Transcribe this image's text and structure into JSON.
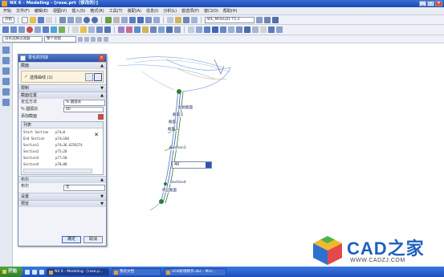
{
  "window": {
    "title": "NX 6 - Modeling - [rose.prt（修改的）]"
  },
  "menu": {
    "items": [
      "开始",
      "文件(F)",
      "编辑(E)",
      "视图(V)",
      "插入(S)",
      "格式(R)",
      "工具(T)",
      "装配(A)",
      "信息(I)",
      "分析(L)",
      "首选项(P)",
      "窗口(O)",
      "帮助(H)"
    ]
  },
  "toolbar": {
    "start_label": "开始",
    "layer_combo": "WE_MOULD1 T5.3",
    "filter_combo": "没有选择过滤器",
    "scope_combo": "整个装配"
  },
  "dialog": {
    "title": "变化的扫掠",
    "sections": {
      "section": "截面",
      "select_curve": "选择曲线 (1)",
      "constraint": "限制",
      "section_position": "截面位置",
      "locate_method_label": "定位方法",
      "locate_method_value": "% 圆弧长",
      "percent_label": "% 圆弧长",
      "percent_value": "40",
      "add_section": "添加截面",
      "list_header": "列表",
      "sections_list": [
        {
          "name": "Start Section",
          "value": "p74=0"
        },
        {
          "name": "End Section",
          "value": "p74=100"
        },
        {
          "name": "Section1",
          "value": "p74=36.6256274"
        },
        {
          "name": "Section2",
          "value": "p75=20"
        },
        {
          "name": "Section3",
          "value": "p77=50"
        },
        {
          "name": "Section4",
          "value": "p78=80"
        }
      ],
      "boolean": "布尔",
      "boolean_label": "布尔",
      "boolean_value": "无",
      "settings": "设置",
      "preview": "预览"
    },
    "ok": "确定",
    "cancel": "取消"
  },
  "viewport": {
    "labels": {
      "start_section": "起始截面",
      "section2": "截面 2",
      "section": "截面",
      "section1": "截面 1",
      "section3": "Section3",
      "section4": "Section4",
      "end_section": "终止截面"
    },
    "inline_input": "40"
  },
  "watermark": {
    "text": "CAD之家",
    "url": "WWW.CADZJ.COM"
  },
  "taskbar": {
    "start": "开始",
    "tasks": [
      "NX 6 - Modeling - [rose.p...",
      "我的文档",
      "UG6拆缝制作.doc - Micr..."
    ]
  },
  "colors": {
    "accent": "#2a55b5",
    "curve": "#2e7d32",
    "highlight": "#e6a23c"
  }
}
